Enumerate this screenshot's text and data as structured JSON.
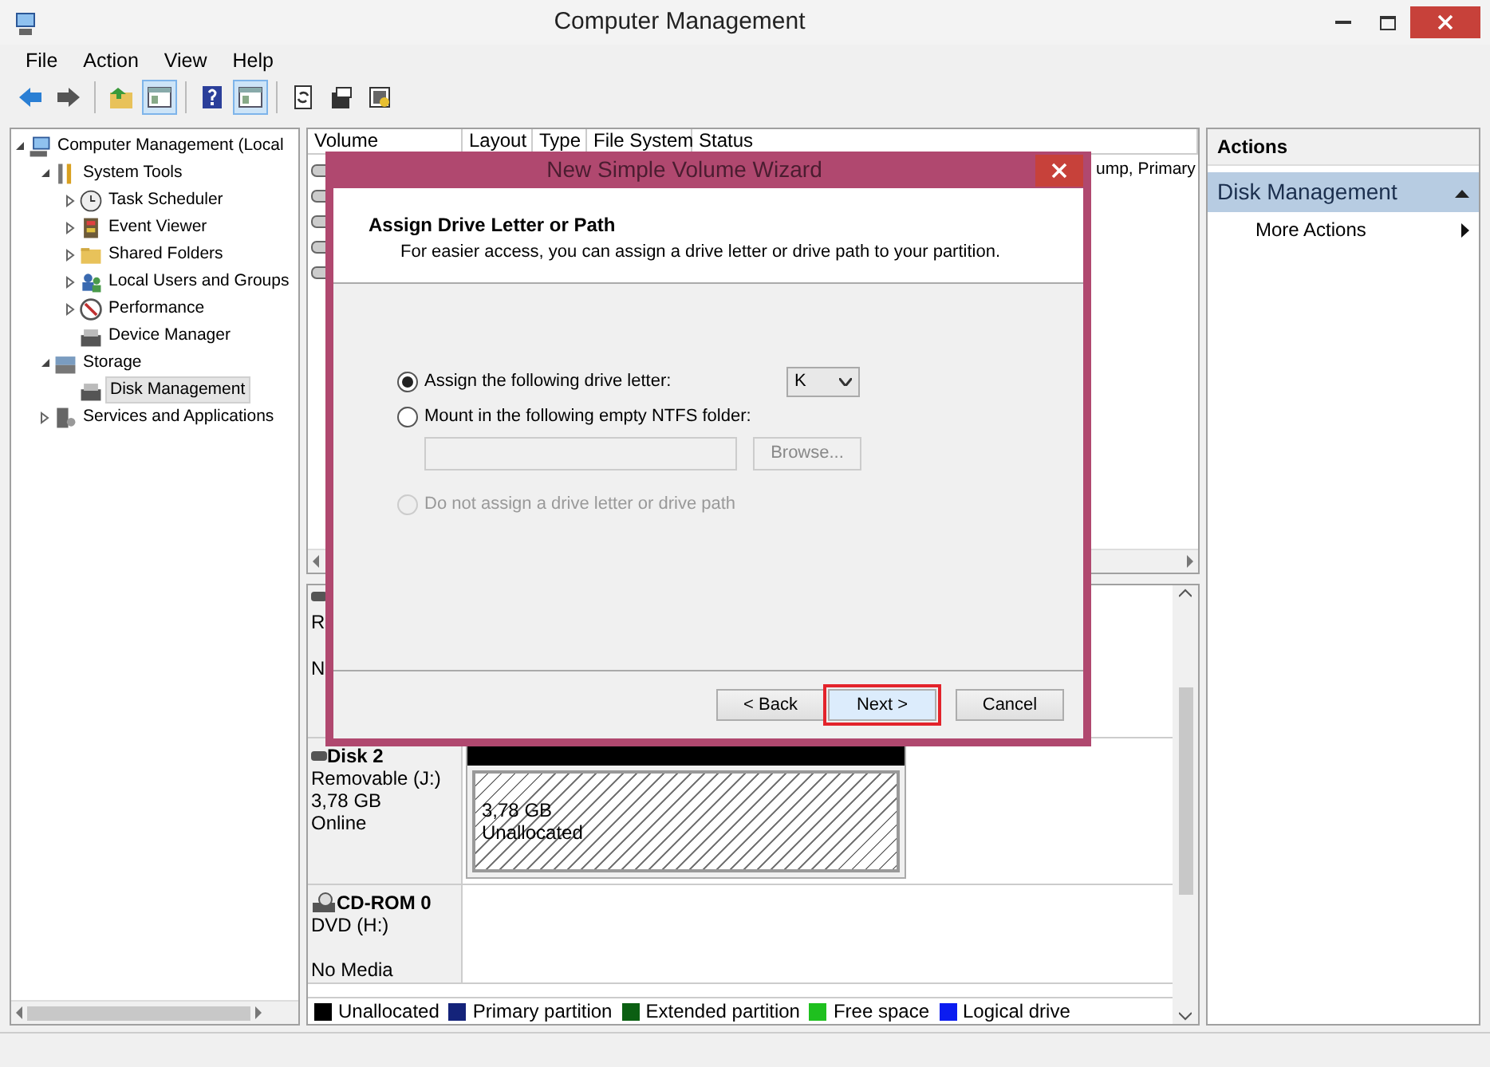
{
  "window": {
    "title": "Computer Management"
  },
  "menu": [
    "File",
    "Action",
    "View",
    "Help"
  ],
  "toolbar": [
    {
      "kind": "back",
      "pressed": false
    },
    {
      "kind": "forward",
      "pressed": false
    },
    {
      "kind": "up",
      "pressed": false
    },
    {
      "kind": "panel",
      "pressed": true
    },
    {
      "kind": "help",
      "pressed": false
    },
    {
      "kind": "panel",
      "pressed": true
    },
    {
      "kind": "refresh",
      "pressed": false
    },
    {
      "kind": "properties",
      "pressed": false
    },
    {
      "kind": "settings",
      "pressed": false
    }
  ],
  "tree": [
    {
      "label": "Computer Management (Local",
      "kind": "computer",
      "expanded": true,
      "selected": false,
      "children": [
        {
          "label": "System Tools",
          "kind": "tools",
          "expanded": true,
          "selected": false,
          "children": [
            {
              "label": "Task Scheduler",
              "kind": "clock",
              "expanded": false,
              "selected": false
            },
            {
              "label": "Event Viewer",
              "kind": "log",
              "expanded": false,
              "selected": false
            },
            {
              "label": "Shared Folders",
              "kind": "folder",
              "expanded": false,
              "selected": false
            },
            {
              "label": "Local Users and Groups",
              "kind": "users",
              "expanded": false,
              "selected": false
            },
            {
              "label": "Performance",
              "kind": "gauge",
              "expanded": false,
              "selected": false
            },
            {
              "label": "Device Manager",
              "kind": "device",
              "selected": false
            }
          ]
        },
        {
          "label": "Storage",
          "kind": "storage",
          "expanded": true,
          "selected": false,
          "children": [
            {
              "label": "Disk Management",
              "kind": "device",
              "selected": true
            }
          ]
        },
        {
          "label": "Services and Applications",
          "kind": "services",
          "expanded": false,
          "selected": false
        }
      ]
    }
  ],
  "volumes": {
    "columns": [
      "Volume",
      "Layout",
      "Type",
      "File System",
      "Status"
    ],
    "rows": [
      {
        "kind": "volume",
        "status": "ump, Primary"
      },
      {
        "kind": "volume"
      },
      {
        "kind": "volume"
      },
      {
        "kind": "volume"
      },
      {
        "kind": "volume"
      }
    ]
  },
  "disks": [
    {
      "kind": "disk",
      "lines": [
        "R",
        "N"
      ]
    },
    {
      "kind": "disk",
      "name": "Disk 2",
      "lines": [
        "Removable (J:)",
        "3,78 GB",
        "Online"
      ],
      "partitions": [
        {
          "kind": "unallocated",
          "size": "3,78 GB",
          "label": "Unallocated"
        }
      ]
    },
    {
      "kind": "cdrom",
      "name": "CD-ROM 0",
      "lines": [
        "DVD (H:)"
      ],
      "status": "No Media"
    }
  ],
  "legend": [
    {
      "label": "Unallocated",
      "color": "#000000"
    },
    {
      "label": "Primary partition",
      "color": "#14237a"
    },
    {
      "label": "Extended partition",
      "color": "#0b5f12"
    },
    {
      "label": "Free space",
      "color": "#1fc01f"
    },
    {
      "label": "Logical drive",
      "color": "#0b1cf0"
    }
  ],
  "actions": {
    "title": "Actions",
    "groups": [
      {
        "label": "Disk Management",
        "expanded": true,
        "items": [
          {
            "label": "More Actions"
          }
        ]
      }
    ]
  },
  "dialog": {
    "title": "New Simple Volume Wizard",
    "heading": "Assign Drive Letter or Path",
    "subheading": "For easier access, you can assign a drive letter or drive path to your partition.",
    "options": [
      {
        "kind": "letter",
        "label": "Assign the following drive letter:",
        "selected": true,
        "disabled": false,
        "value": "K"
      },
      {
        "kind": "folder",
        "label": "Mount in the following empty NTFS folder:",
        "selected": false,
        "disabled": false,
        "field_disabled": true,
        "button": "Browse...",
        "button_disabled": true
      },
      {
        "kind": "plain",
        "label": "Do not assign a drive letter or drive path",
        "selected": false,
        "disabled": true
      }
    ],
    "buttons": [
      {
        "label": "< Back",
        "focused": false
      },
      {
        "label": "Next >",
        "focused": true
      },
      {
        "label": "Cancel",
        "focused": false
      }
    ]
  }
}
